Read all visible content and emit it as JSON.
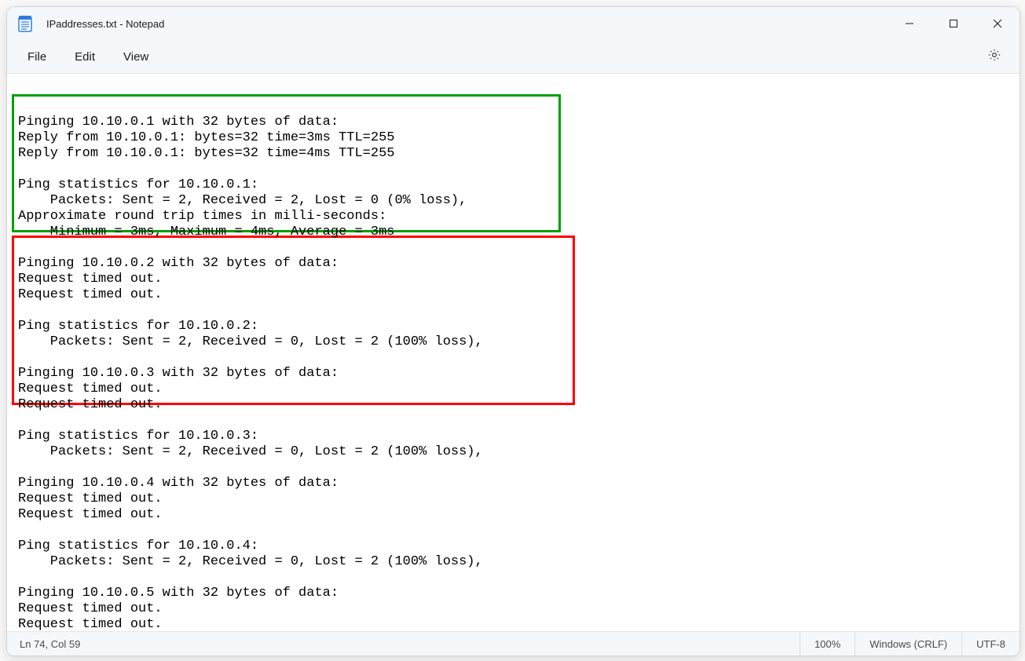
{
  "window": {
    "title": "IPaddresses.txt - Notepad"
  },
  "menu": {
    "file": "File",
    "edit": "Edit",
    "view": "View"
  },
  "content": {
    "text": "\nPinging 10.10.0.1 with 32 bytes of data:\nReply from 10.10.0.1: bytes=32 time=3ms TTL=255\nReply from 10.10.0.1: bytes=32 time=4ms TTL=255\n\nPing statistics for 10.10.0.1:\n    Packets: Sent = 2, Received = 2, Lost = 0 (0% loss),\nApproximate round trip times in milli-seconds:\n    Minimum = 3ms, Maximum = 4ms, Average = 3ms\n\nPinging 10.10.0.2 with 32 bytes of data:\nRequest timed out.\nRequest timed out.\n\nPing statistics for 10.10.0.2:\n    Packets: Sent = 2, Received = 0, Lost = 2 (100% loss),\n\nPinging 10.10.0.3 with 32 bytes of data:\nRequest timed out.\nRequest timed out.\n\nPing statistics for 10.10.0.3:\n    Packets: Sent = 2, Received = 0, Lost = 2 (100% loss),\n\nPinging 10.10.0.4 with 32 bytes of data:\nRequest timed out.\nRequest timed out.\n\nPing statistics for 10.10.0.4:\n    Packets: Sent = 2, Received = 0, Lost = 2 (100% loss),\n\nPinging 10.10.0.5 with 32 bytes of data:\nRequest timed out.\nRequest timed out."
  },
  "status": {
    "position": "Ln 74, Col 59",
    "zoom": "100%",
    "line_ending": "Windows (CRLF)",
    "encoding": "UTF-8"
  }
}
